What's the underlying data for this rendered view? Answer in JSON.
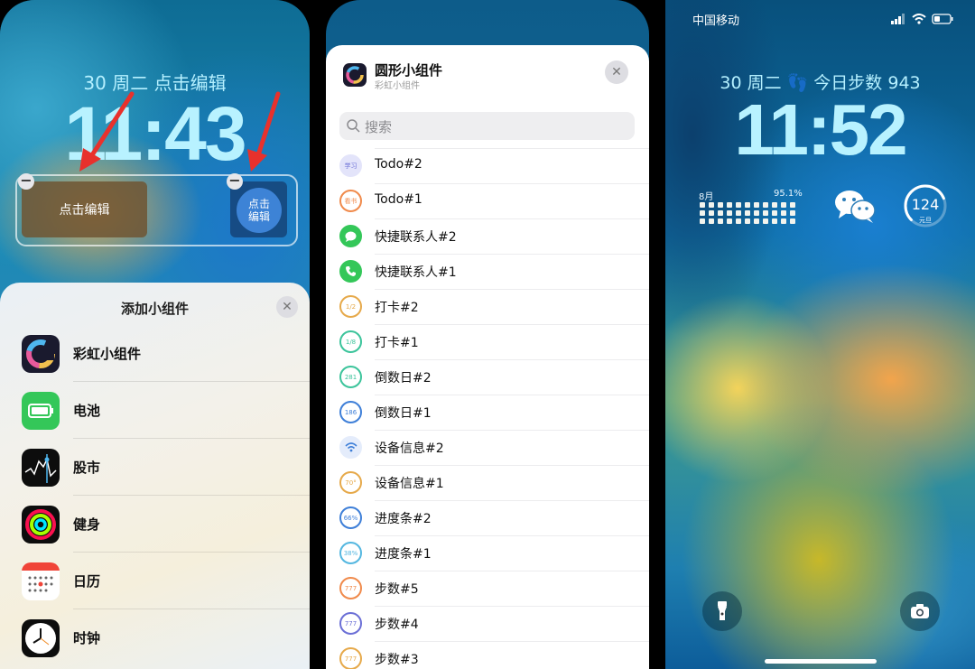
{
  "colors": {
    "accent": "#3d83d6",
    "arrow": "#e8312c",
    "lock_text": "#b8f2ff"
  },
  "panel1": {
    "lock": {
      "date": "30 周二  点击编辑",
      "time": "11:43"
    },
    "edit": {
      "rect_widget_label": "点击编辑",
      "circle_widget_label": "点击\n编辑"
    },
    "sheet": {
      "title": "添加小组件",
      "apps": [
        {
          "label": "彩虹小组件",
          "icon": "rainbow-widget-icon"
        },
        {
          "label": "电池",
          "icon": "battery-icon"
        },
        {
          "label": "股市",
          "icon": "stocks-icon"
        },
        {
          "label": "健身",
          "icon": "fitness-rings-icon"
        },
        {
          "label": "日历",
          "icon": "calendar-icon"
        },
        {
          "label": "时钟",
          "icon": "clock-icon"
        }
      ]
    }
  },
  "panel2": {
    "header": {
      "title": "圆形小组件",
      "subtitle": "彩虹小组件"
    },
    "search": {
      "placeholder": "搜索"
    },
    "items": [
      {
        "label": "Todo#2",
        "badge": "学习",
        "color": "#6b6fd6",
        "bg": "#e3e4fa"
      },
      {
        "label": "Todo#1",
        "badge": "看书",
        "color": "#f08a4b",
        "bg": "#fff"
      },
      {
        "label": "快捷联系人#2",
        "badge": "",
        "color": "#fff",
        "bg": "#34c759"
      },
      {
        "label": "快捷联系人#1",
        "badge": "",
        "color": "#fff",
        "bg": "#34c759"
      },
      {
        "label": "打卡#2",
        "badge": "1/2",
        "color": "#e6a94a",
        "bg": "#fff"
      },
      {
        "label": "打卡#1",
        "badge": "1/8",
        "color": "#3cc49b",
        "bg": "#fff"
      },
      {
        "label": "倒数日#2",
        "badge": "281",
        "color": "#3cc49b",
        "bg": "#fff"
      },
      {
        "label": "倒数日#1",
        "badge": "186",
        "color": "#3e7fd8",
        "bg": "#fff"
      },
      {
        "label": "设备信息#2",
        "badge": "",
        "color": "#3e7fd8",
        "bg": "#e4ecfb"
      },
      {
        "label": "设备信息#1",
        "badge": "70°",
        "color": "#e6a94a",
        "bg": "#fff"
      },
      {
        "label": "进度条#2",
        "badge": "66%",
        "color": "#3e7fd8",
        "bg": "#fff"
      },
      {
        "label": "进度条#1",
        "badge": "38%",
        "color": "#54b7e0",
        "bg": "#fff"
      },
      {
        "label": "步数#5",
        "badge": "777",
        "color": "#f08a4b",
        "bg": "#fff"
      },
      {
        "label": "步数#4",
        "badge": "777",
        "color": "#6b6fd6",
        "bg": "#fff"
      },
      {
        "label": "步数#3",
        "badge": "777",
        "color": "#e6a94a",
        "bg": "#fff"
      }
    ]
  },
  "panel3": {
    "status": {
      "carrier": "中国移动"
    },
    "lock": {
      "date": "30 周二  👣 今日步数 943",
      "time": "11:52"
    },
    "widgets": {
      "month": "8月",
      "percent": "95.1%",
      "gauge_value": "124",
      "gauge_unit": "元旦",
      "gauge_level": 0.75
    },
    "buttons": {
      "flashlight": "flashlight-icon",
      "camera": "camera-icon"
    }
  }
}
